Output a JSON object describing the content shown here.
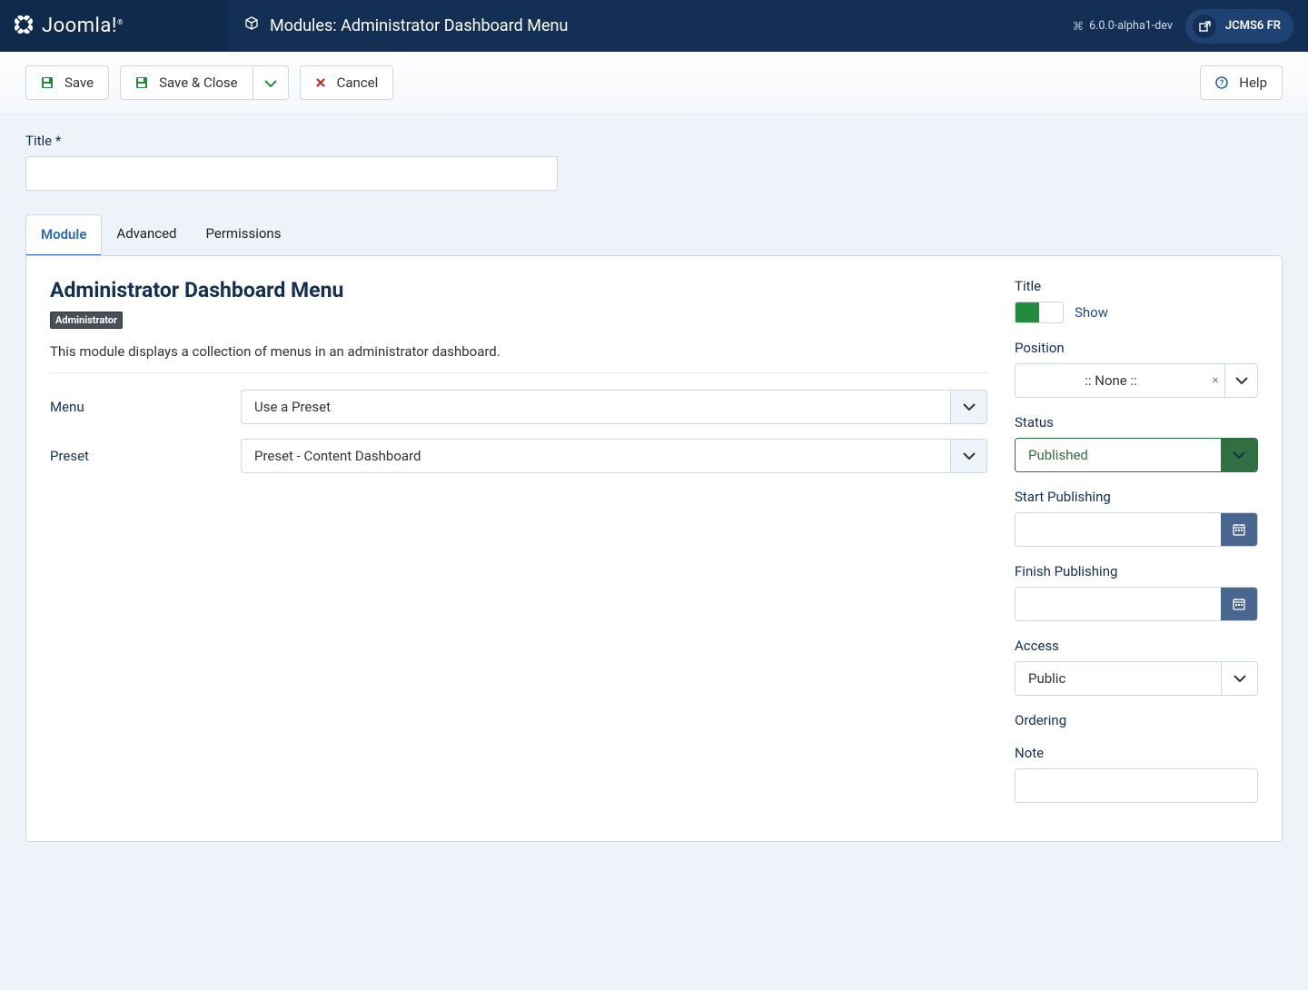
{
  "header": {
    "brand": "Joomla!",
    "page_title": "Modules: Administrator Dashboard Menu",
    "version": "6.0.0-alpha1-dev",
    "site_name": "JCMS6 FR"
  },
  "toolbar": {
    "save": "Save",
    "save_close": "Save & Close",
    "cancel": "Cancel",
    "help": "Help"
  },
  "form": {
    "title_label": "Title *",
    "title_value": ""
  },
  "tabs": {
    "module": "Module",
    "advanced": "Advanced",
    "permissions": "Permissions"
  },
  "module": {
    "heading": "Administrator Dashboard Menu",
    "badge": "Administrator",
    "description": "This module displays a collection of menus in an administrator dashboard.",
    "menu_label": "Menu",
    "menu_value": "Use a Preset",
    "preset_label": "Preset",
    "preset_value": "Preset - Content Dashboard"
  },
  "side": {
    "title_label": "Title",
    "title_toggle": "Show",
    "position_label": "Position",
    "position_value": ":: None ::",
    "status_label": "Status",
    "status_value": "Published",
    "start_label": "Start Publishing",
    "start_value": "",
    "finish_label": "Finish Publishing",
    "finish_value": "",
    "access_label": "Access",
    "access_value": "Public",
    "ordering_label": "Ordering",
    "note_label": "Note",
    "note_value": ""
  }
}
